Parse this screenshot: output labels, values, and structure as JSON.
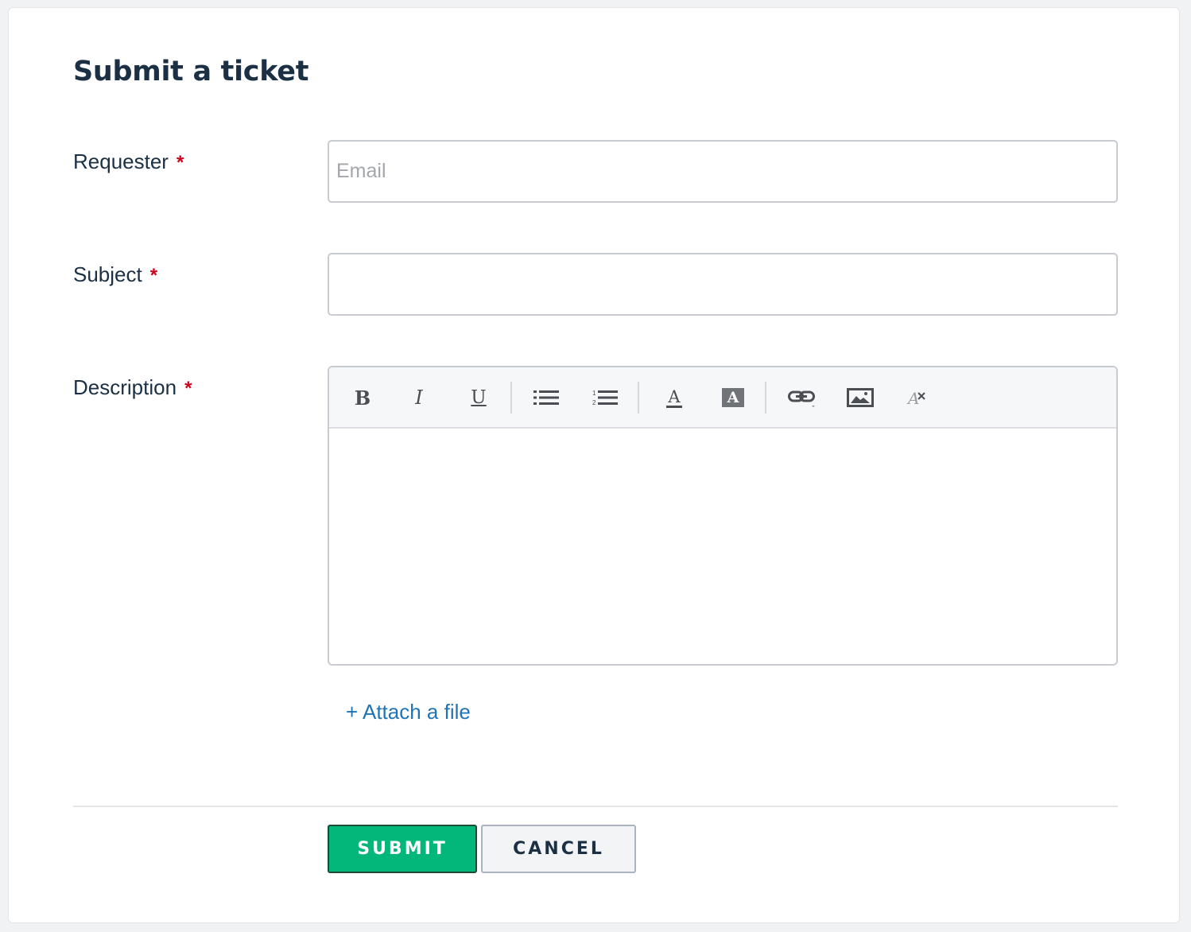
{
  "form": {
    "title": "Submit a ticket",
    "required_marker": "*",
    "requester": {
      "label": "Requester",
      "placeholder": "Email",
      "value": ""
    },
    "subject": {
      "label": "Subject",
      "placeholder": "",
      "value": ""
    },
    "description": {
      "label": "Description",
      "value": ""
    },
    "toolbar": {
      "bold_label": "B",
      "italic_label": "I",
      "underline_label": "U",
      "font_color_label": "A",
      "background_color_label": "A",
      "icons": [
        "bold-icon",
        "italic-icon",
        "underline-icon",
        "bulleted-list-icon",
        "numbered-list-icon",
        "font-color-icon",
        "background-color-icon",
        "link-icon",
        "image-icon",
        "clear-formatting-icon"
      ]
    },
    "attach_label": "+ Attach a file",
    "submit_label": "SUBMIT",
    "cancel_label": "CANCEL"
  },
  "colors": {
    "primary_text": "#1b3044",
    "required": "#d0021b",
    "link": "#1f73b7",
    "submit_bg": "#03b77b",
    "cancel_bg": "#f3f4f6"
  }
}
